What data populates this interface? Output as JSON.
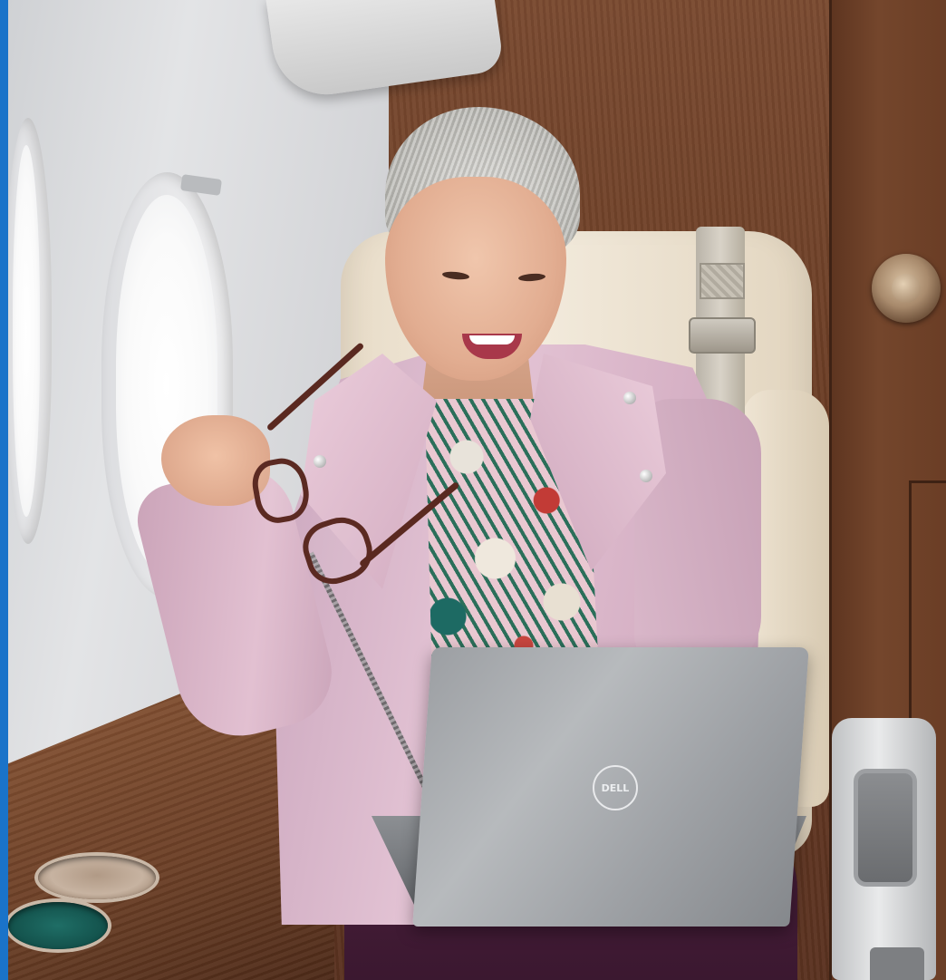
{
  "photo": {
    "alt": "",
    "accent_strip_color": "#1a73c9"
  },
  "laptop": {
    "logo_text": "DELL",
    "color": "#9fa2a6"
  },
  "jacket": {
    "color": "#dcb8cb"
  },
  "pants": {
    "color": "#44203a"
  },
  "wood": {
    "color": "#6a3c24"
  }
}
